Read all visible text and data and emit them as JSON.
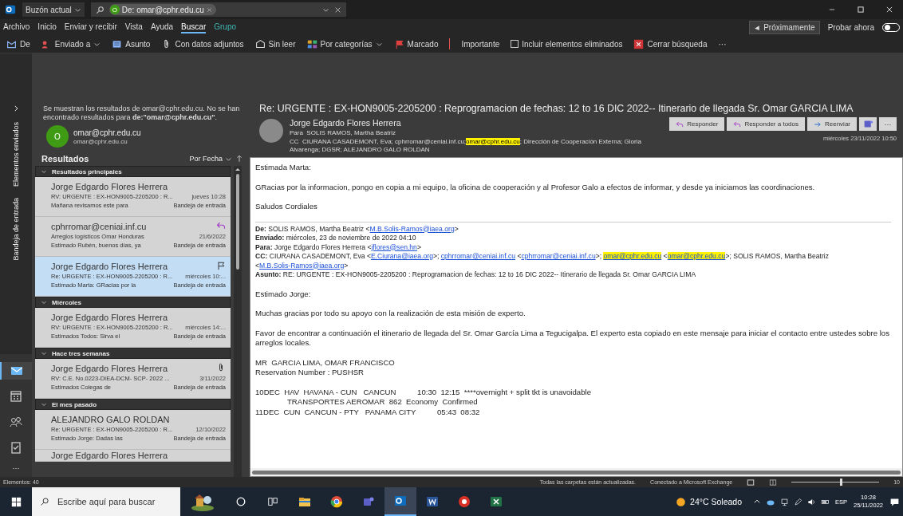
{
  "title_bar": {
    "scope": "Buzón actual",
    "chip_avatar": "O",
    "chip_text": "De: omar@cphr.edu.cu"
  },
  "menu": {
    "tabs": [
      {
        "label": "Archivo",
        "selected": false,
        "contextual": false
      },
      {
        "label": "Inicio",
        "selected": false,
        "contextual": false
      },
      {
        "label": "Enviar y recibir",
        "selected": false,
        "contextual": false
      },
      {
        "label": "Vista",
        "selected": false,
        "contextual": false
      },
      {
        "label": "Ayuda",
        "selected": false,
        "contextual": false
      },
      {
        "label": "Buscar",
        "selected": true,
        "contextual": false
      },
      {
        "label": "Grupo",
        "selected": false,
        "contextual": true
      }
    ],
    "coming_soon": "Próximamente",
    "try_now": "Probar ahora",
    "try_now_on": false
  },
  "ribbon": {
    "buttons": [
      {
        "label": "De",
        "dropdown": false
      },
      {
        "label": "Enviado a",
        "dropdown": true
      },
      {
        "label": "Asunto",
        "dropdown": false
      },
      {
        "label": "Con datos adjuntos",
        "dropdown": false
      },
      {
        "label": "Sin leer",
        "dropdown": false
      },
      {
        "label": "Por categorías",
        "dropdown": true
      },
      {
        "label": "Marcado",
        "dropdown": false
      },
      {
        "label": "Importante",
        "dropdown": false
      }
    ],
    "include_deleted": {
      "label": "Incluir elementos eliminados",
      "checked": false
    },
    "close_search": "Cerrar búsqueda",
    "more": "···"
  },
  "nav": {
    "folders": [
      "Bandeja de entrada",
      "Elementos enviados"
    ],
    "apps": [
      {
        "kind": "mail",
        "selected": true
      },
      {
        "kind": "calendar",
        "selected": false
      },
      {
        "kind": "people",
        "selected": false
      },
      {
        "kind": "tasks",
        "selected": false
      }
    ],
    "more": "···"
  },
  "results": {
    "notice": "Se muestran los resultados de omar@cphr.edu.cu. No se han encontrado resultados para **de:\"omar@cphr.edu.cu\"**.",
    "contact": {
      "avatar": "O",
      "name": "omar@cphr.edu.cu",
      "email": "omar@cphr.edu.cu"
    },
    "heading": "Resultados",
    "sort": "Por Fecha",
    "groups": [
      {
        "label": "Resultados principales",
        "expanded": true,
        "items": [
          {
            "sender": "Jorge Edgardo Flores Herrera",
            "subject": "RV: URGENTE : EX-HON9005-2205200 : R...",
            "date": "jueves 10:28",
            "preview": "Mañana revisamos este para",
            "folder": "Bandeja de entrada",
            "selected": false,
            "replied": false,
            "flagged": false,
            "attachment": false
          },
          {
            "sender": "cphrromar@ceniai.inf.cu",
            "subject": "Arreglos logísticos Omar Honduras",
            "date": "21/6/2022",
            "preview": "Estimado Rubén, buenos días, ya",
            "folder": "Bandeja de entrada",
            "selected": false,
            "replied": true,
            "flagged": false,
            "attachment": false
          },
          {
            "sender": "Jorge Edgardo Flores Herrera",
            "subject": "Re: URGENTE : EX-HON9005-2205200 : R...",
            "date": "miércoles 10:...",
            "preview": "Estimado Marta: GRacias por la",
            "folder": "Bandeja de entrada",
            "selected": true,
            "replied": false,
            "flagged": true,
            "attachment": false
          }
        ]
      },
      {
        "label": "Miércoles",
        "expanded": true,
        "items": [
          {
            "sender": "Jorge Edgardo Flores Herrera",
            "subject": "RV: URGENTE : EX-HON9005-2205200 : R...",
            "date": "miércoles 14:...",
            "preview": "Estimados Todos: Sirva el",
            "folder": "Bandeja de entrada",
            "selected": false,
            "replied": false,
            "flagged": false,
            "attachment": false
          }
        ]
      },
      {
        "label": "Hace tres semanas",
        "expanded": true,
        "items": [
          {
            "sender": "Jorge Edgardo Flores Herrera",
            "subject": "RV: C.E. No.0223-DIEA-DCM- SCP- 2022 ...",
            "date": "3/11/2022",
            "preview": "Estimados Colegas de",
            "folder": "Bandeja de entrada",
            "selected": false,
            "replied": false,
            "flagged": false,
            "attachment": true
          }
        ]
      },
      {
        "label": "El mes pasado",
        "expanded": true,
        "items": [
          {
            "sender": "ALEJANDRO GALO ROLDAN",
            "subject": "Re: URGENTE : EX-HON9005-2205200 : R...",
            "date": "12/10/2022",
            "preview": "Estimado Jorge: Dadas las",
            "folder": "Bandeja de entrada",
            "selected": false,
            "replied": false,
            "flagged": false,
            "attachment": false
          },
          {
            "sender": "Jorge Edgardo Flores Herrera",
            "selected": false,
            "replied": false,
            "flagged": false,
            "attachment": false
          }
        ]
      }
    ]
  },
  "message": {
    "subject": "Re: URGENTE : EX-HON9005-2205200 : Reprogramacion de fechas: 12 to 16 DIC 2022-- Itinerario de llegada Sr. Omar GARCIA LIMA",
    "sender": "Jorge Edgardo Flores Herrera",
    "to_label": "Para",
    "to": "SOLIS RAMOS, Martha Beatriz",
    "cc_label": "CC",
    "cc": [
      {
        "text": "CIURANA CASADEMONT, Eva; cphrromar@ceniai.inf.cu;",
        "kind": "plain"
      },
      {
        "text": "omar@cphr.edu.cu",
        "kind": "mark"
      },
      {
        "text": "; Dirección de Cooperación Externa; Gloria Alvarenga; DGSR; ALEJANDRO GALO ROLDAN",
        "kind": "plain"
      }
    ],
    "actions": [
      "Responder",
      "Responder a todos",
      "Reenviar"
    ],
    "more": "···",
    "date": "miércoles 23/11/2022 10:50",
    "body": [
      {
        "kind": "para",
        "segments": [
          {
            "text": "Estimada Marta:",
            "kind": "plain"
          }
        ]
      },
      {
        "kind": "para",
        "segments": [
          {
            "text": "GRacias por la informacion, pongo en copia a mi equipo, la oficina de cooperación y al Profesor Galo a efectos de informar, y desde ya iniciamos las coordinaciones.",
            "kind": "plain"
          }
        ]
      },
      {
        "kind": "para",
        "segments": [
          {
            "text": "Saludos Cordiales",
            "kind": "plain"
          }
        ]
      },
      {
        "kind": "field",
        "segments": [
          {
            "text": "De:",
            "kind": "bold"
          },
          {
            "text": " SOLIS RAMOS, Martha Beatriz <",
            "kind": "plain"
          },
          {
            "text": "M.B.Solis-Ramos@iaea.org",
            "kind": "link"
          },
          {
            "text": ">",
            "kind": "plain"
          }
        ]
      },
      {
        "kind": "field",
        "segments": [
          {
            "text": "Enviado:",
            "kind": "bold"
          },
          {
            "text": " miércoles, 23 de noviembre de 2022 04:10",
            "kind": "plain"
          }
        ]
      },
      {
        "kind": "field",
        "segments": [
          {
            "text": "Para:",
            "kind": "bold"
          },
          {
            "text": " Jorge Edgardo Flores Herrera <",
            "kind": "plain"
          },
          {
            "text": "jflores@sen.hn",
            "kind": "link"
          },
          {
            "text": ">",
            "kind": "plain"
          }
        ]
      },
      {
        "kind": "field",
        "segments": [
          {
            "text": "CC:",
            "kind": "bold"
          },
          {
            "text": " CIURANA CASADEMONT, Eva <",
            "kind": "plain"
          },
          {
            "text": "E.Ciurana@iaea.org",
            "kind": "link"
          },
          {
            "text": ">; ",
            "kind": "plain"
          },
          {
            "text": "cphrromar@ceniai.inf.cu",
            "kind": "link"
          },
          {
            "text": " <",
            "kind": "plain"
          },
          {
            "text": "cphrromar@ceniai.inf.cu",
            "kind": "link"
          },
          {
            "text": ">; ",
            "kind": "plain"
          },
          {
            "text": "omar@cphr.edu.cu",
            "kind": "marked-link"
          },
          {
            "text": " <",
            "kind": "plain"
          },
          {
            "text": "omar@cphr.edu.cu",
            "kind": "marked-link"
          },
          {
            "text": ">; SOLIS RAMOS, Martha Beatriz <",
            "kind": "plain"
          },
          {
            "text": "M.B.Solis-Ramos@iaea.org",
            "kind": "link"
          },
          {
            "text": ">",
            "kind": "plain"
          }
        ]
      },
      {
        "kind": "field",
        "segments": [
          {
            "text": "Asunto:",
            "kind": "bold"
          },
          {
            "text": " RE: URGENTE : EX-HON9005-2205200 : Reprogramacion de fechas: 12 to 16 DIC 2022-- Itinerario de llegada Sr. Omar GARCIA LIMA",
            "kind": "plain"
          }
        ]
      },
      {
        "kind": "para",
        "segments": [
          {
            "text": "Estimado Jorge:",
            "kind": "plain"
          }
        ]
      },
      {
        "kind": "para",
        "segments": [
          {
            "text": "Muchas gracias por todo su apoyo con la realización de esta misión de experto.",
            "kind": "plain"
          }
        ]
      },
      {
        "kind": "para",
        "segments": [
          {
            "text": "Favor de encontrar a continuación el itinerario de llegada del Sr. Omar García Lima a Tegucigalpa. El experto esta copiado en este mensaje para iniciar el contacto entre ustedes sobre los arreglos locales.",
            "kind": "plain"
          }
        ]
      },
      {
        "kind": "line",
        "segments": [
          {
            "text": "MR  GARCIA LIMA, OMAR FRANCISCO",
            "kind": "plain"
          }
        ]
      },
      {
        "kind": "para",
        "segments": [
          {
            "text": "Reservation Number : PUSHSR",
            "kind": "plain"
          }
        ]
      },
      {
        "kind": "line",
        "segments": [
          {
            "text": "10DEC  HAV  HAVANA - CUN   CANCUN          10:30  12:15  ****overnight + split tkt is unavoidable",
            "kind": "plain"
          }
        ]
      },
      {
        "kind": "indent",
        "segments": [
          {
            "text": "TRANSPORTES AEROMAR  862  Economy  Confirmed",
            "kind": "plain"
          }
        ]
      },
      {
        "kind": "line",
        "segments": [
          {
            "text": "11DEC  CUN  CANCUN - PTY   PANAMA CITY          05:43  08:32",
            "kind": "plain"
          }
        ]
      }
    ]
  },
  "status_bar": {
    "items": "Elementos: 40",
    "sync": "Todas las carpetas están actualizadas.",
    "connection": "Conectado a Microsoft Exchange",
    "level": 0.55,
    "zoom": "10"
  },
  "taskbar": {
    "search_placeholder": "Escribe aquí para buscar",
    "apps": [
      {
        "kind": "explorer",
        "open": false
      },
      {
        "kind": "browser",
        "open": false
      },
      {
        "kind": "chat",
        "open": false
      },
      {
        "kind": "mail",
        "open": true
      },
      {
        "kind": "word",
        "open": false
      },
      {
        "kind": "browser2",
        "open": false
      },
      {
        "kind": "sheet",
        "open": false
      }
    ],
    "weather": "24°C  Soleado",
    "language": "ESP",
    "time": "10:28",
    "date": "25/11/2022"
  }
}
